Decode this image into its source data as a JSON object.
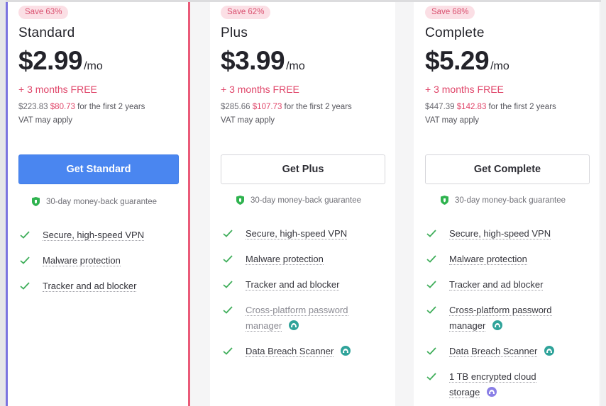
{
  "colors": {
    "primary_button": "#4a86f0",
    "accent_red": "#e0466a",
    "badge_bg": "#fbdfe5",
    "check_green": "#3fae5a",
    "shield_green": "#2fb34f",
    "addon_teal": "#2fa39a",
    "addon_purple": "#8a7fe6"
  },
  "plans": [
    {
      "badge": "Save 63%",
      "name": "Standard",
      "price": "$2.99",
      "per": "/mo",
      "free": "+ 3 months FREE",
      "original_total": "$223.83",
      "discounted_total": "$80.73",
      "total_suffix": " for the first 2 years",
      "vat": "VAT may apply",
      "cta": "Get Standard",
      "guarantee": "30-day money-back guarantee",
      "features": [
        {
          "label": "Secure, high-speed VPN"
        },
        {
          "label": "Malware protection"
        },
        {
          "label": "Tracker and ad blocker"
        }
      ]
    },
    {
      "badge": "Save 62%",
      "name": "Plus",
      "price": "$3.99",
      "per": "/mo",
      "free": "+ 3 months FREE",
      "original_total": "$285.66",
      "discounted_total": "$107.73",
      "total_suffix": " for the first 2 years",
      "vat": "VAT may apply",
      "cta": "Get Plus",
      "guarantee": "30-day money-back guarantee",
      "features": [
        {
          "label": "Secure, high-speed VPN"
        },
        {
          "label": "Malware protection"
        },
        {
          "label": "Tracker and ad blocker"
        },
        {
          "label_line1": "Cross-platform password",
          "label_line2": "manager",
          "addon": "teal-addon-icon"
        },
        {
          "label": "Data Breach Scanner",
          "addon": "teal-addon-icon"
        }
      ]
    },
    {
      "badge": "Save 68%",
      "name": "Complete",
      "price": "$5.29",
      "per": "/mo",
      "free": "+ 3 months FREE",
      "original_total": "$447.39",
      "discounted_total": "$142.83",
      "total_suffix": " for the first 2 years",
      "vat": "VAT may apply",
      "cta": "Get Complete",
      "guarantee": "30-day money-back guarantee",
      "features": [
        {
          "label": "Secure, high-speed VPN"
        },
        {
          "label": "Malware protection"
        },
        {
          "label": "Tracker and ad blocker"
        },
        {
          "label_line1": "Cross-platform password",
          "label_line2": "manager",
          "addon": "teal-addon-icon"
        },
        {
          "label": "Data Breach Scanner",
          "addon": "teal-addon-icon"
        },
        {
          "label_line1": "1 TB encrypted cloud",
          "label_line2": "storage",
          "addon": "purple-addon-icon"
        }
      ]
    }
  ]
}
